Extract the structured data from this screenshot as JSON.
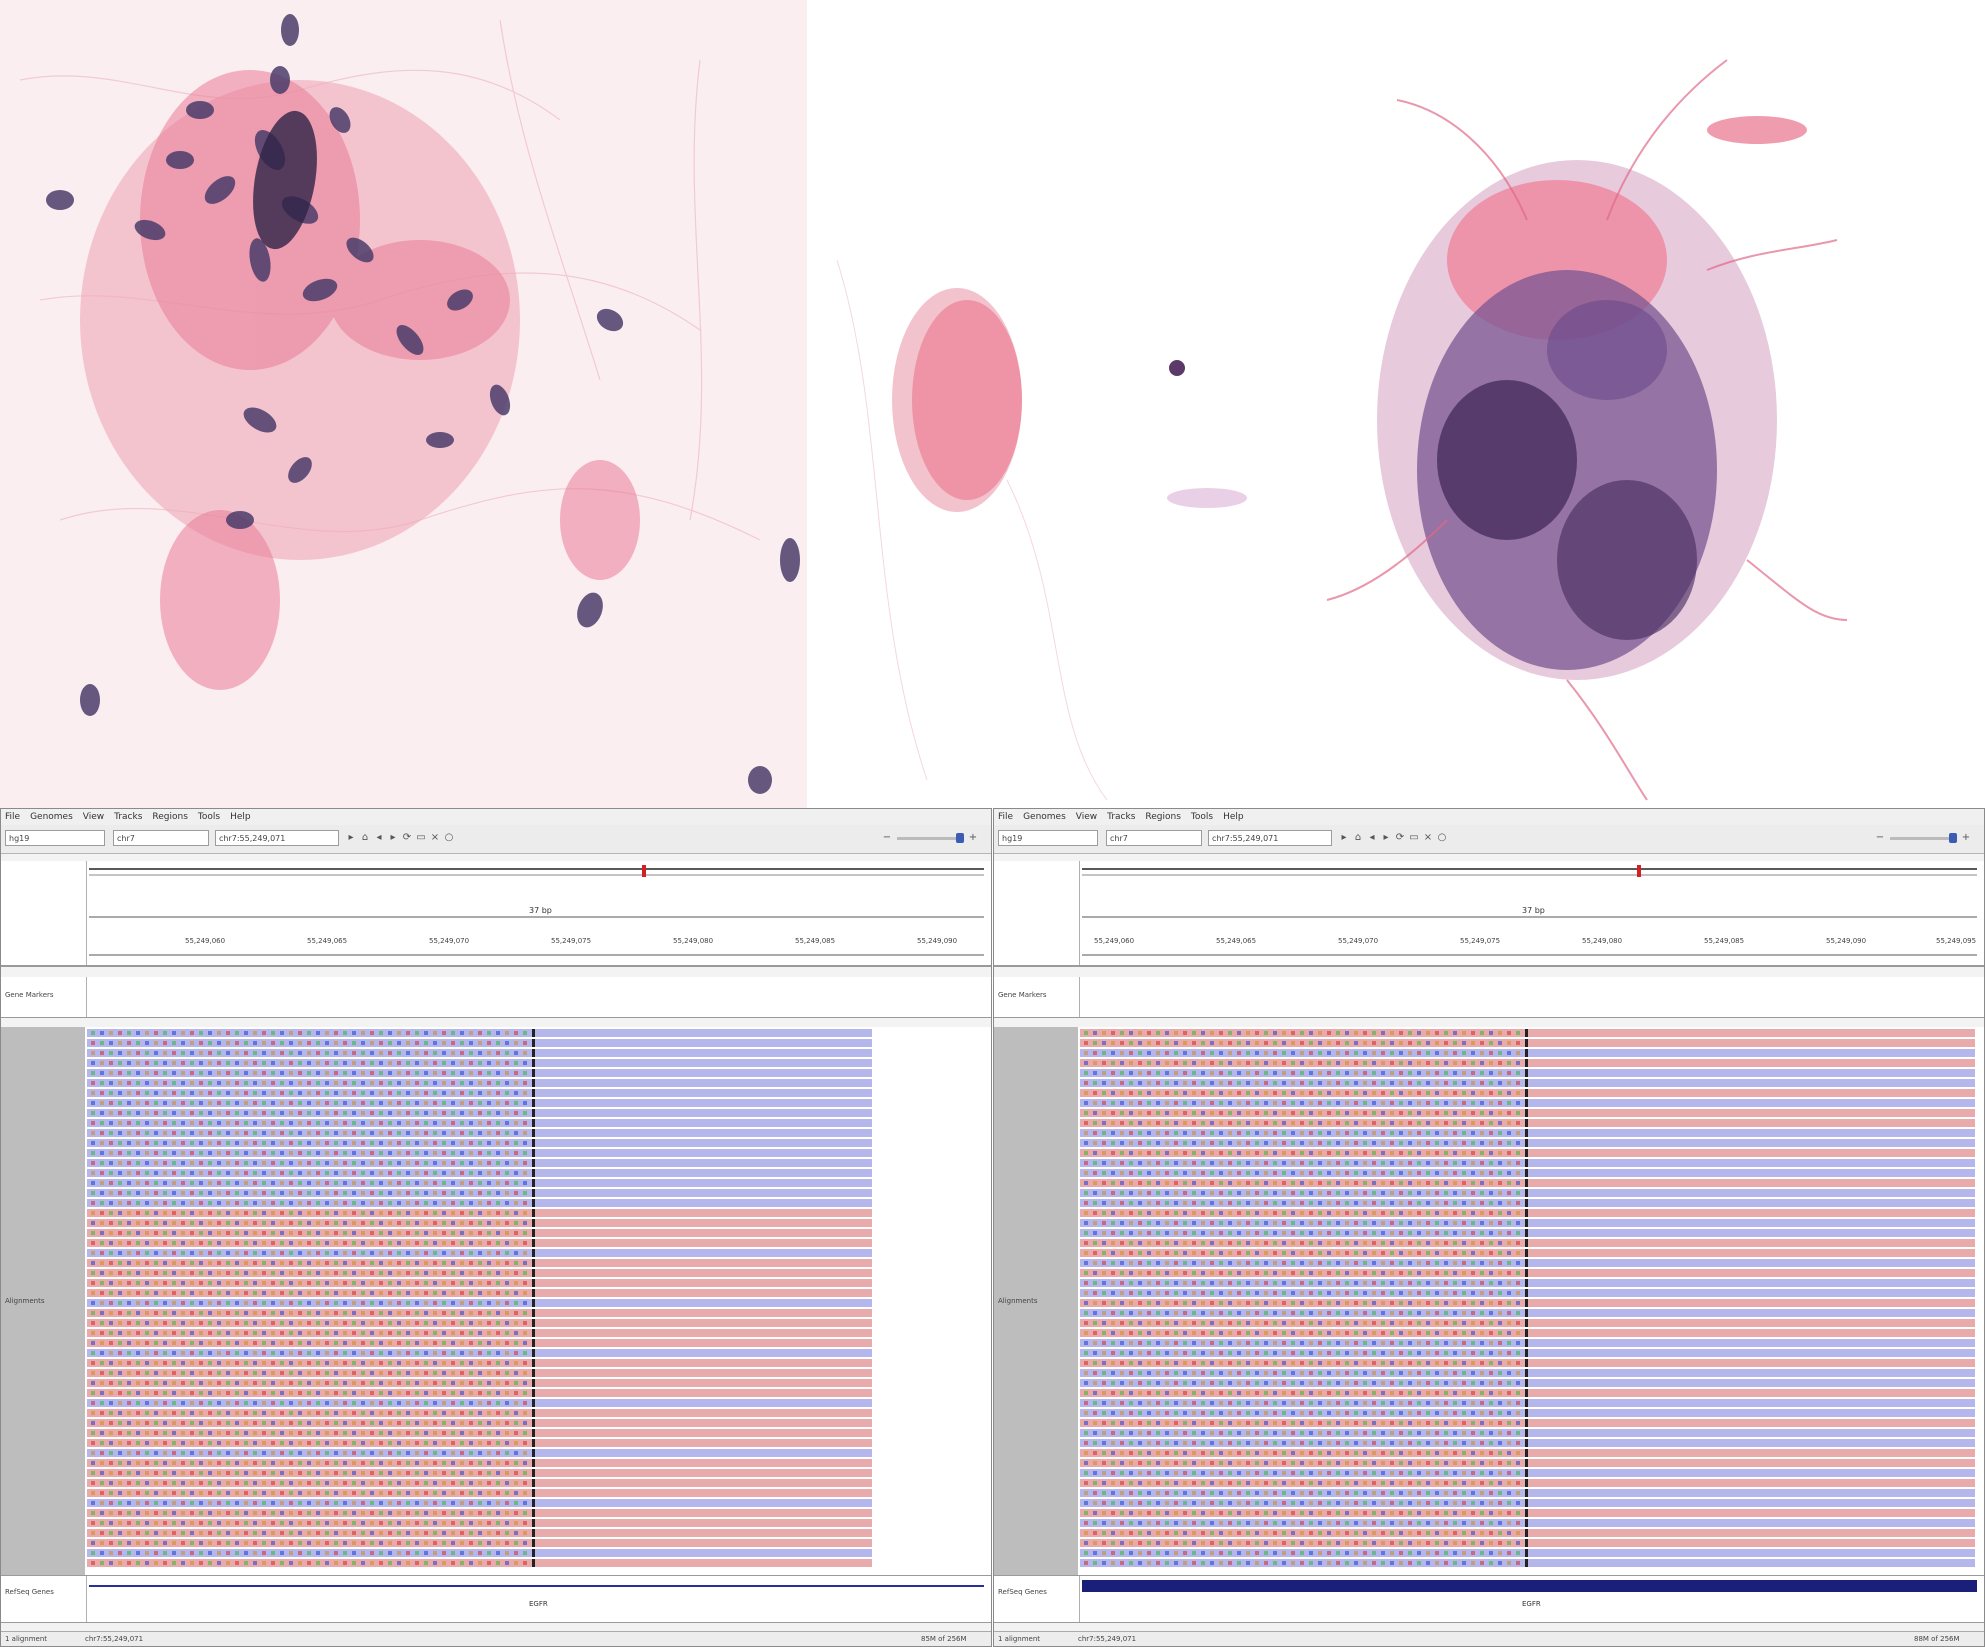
{
  "figure": {
    "panels": [
      {
        "id": "left",
        "label": ""
      },
      {
        "id": "right",
        "label": ""
      }
    ]
  },
  "igv_left": {
    "menu": [
      "File",
      "Genomes",
      "View",
      "Tracks",
      "Regions",
      "Tools",
      "Help"
    ],
    "genome": "hg19",
    "chromosome": "chr7",
    "locus": "chr7:55,249,071",
    "ruler_ticks": [
      "55,249,060",
      "55,249,065",
      "55,249,070",
      "55,249,075",
      "55,249,080",
      "55,249,085",
      "55,249,090"
    ],
    "span": "37 bp",
    "marker_track": "Gene Markers",
    "alignment_track": "Alignments",
    "refseq_track": "RefSeq Genes",
    "refseq_gene": "EGFR",
    "status_left": "1 alignment",
    "status_pos": "chr7:55,249,071",
    "status_right": "85M of 256M"
  },
  "igv_right": {
    "menu": [
      "File",
      "Genomes",
      "View",
      "Tracks",
      "Regions",
      "Tools",
      "Help"
    ],
    "genome": "hg19",
    "chromosome": "chr7",
    "locus": "chr7:55,249,071",
    "ruler_ticks": [
      "55,249,060",
      "55,249,065",
      "55,249,070",
      "55,249,075",
      "55,249,080",
      "55,249,085",
      "55,249,090",
      "55,249,095"
    ],
    "span": "37 bp",
    "marker_track": "Gene Markers",
    "alignment_track": "Alignments",
    "refseq_track": "RefSeq Genes",
    "refseq_gene": "EGFR",
    "status_left": "1 alignment",
    "status_pos": "chr7:55,249,071",
    "status_right": "88M of 256M"
  },
  "colors": {
    "forward_read": "#b4b6ec",
    "reverse_read": "#e8aaaa",
    "stain_pink": "#e56a86",
    "stain_purple": "#5a3a78",
    "refseq_bar": "#1a1f7a"
  }
}
